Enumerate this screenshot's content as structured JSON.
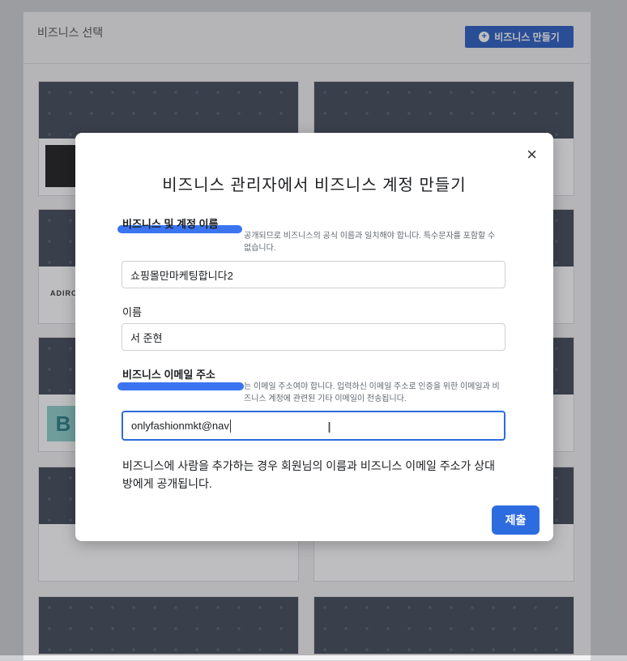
{
  "background": {
    "section_title": "비즈니스 선택",
    "create_button_label": "비즈니스 만들기",
    "cards": [
      {
        "logo_text": ""
      },
      {
        "logo_text": ""
      },
      {
        "logo_text": "ADIRO"
      },
      {
        "logo_text": ""
      },
      {
        "logo_text": "B"
      },
      {
        "logo_text": ""
      }
    ]
  },
  "modal": {
    "title": "비즈니스 관리자에서 비즈니스 계정 만들기",
    "close_symbol": "×",
    "business_name": {
      "label": "비즈니스 및 계정 이름",
      "help": "공개되므로 비즈니스의 공식 이름과 일치해야 합니다. 특수문자를 포함할 수 없습니다.",
      "value": "쇼핑몰만마케팅합니다2"
    },
    "person_name": {
      "label": "이름",
      "value": "서 준현"
    },
    "business_email": {
      "label": "비즈니스 이메일 주소",
      "help": "는 이메일 주소여야 합니다. 입력하신 이메일 주소로 인증을 위한 이메일과 비즈니스 계정에 관련된 기타 이메일이 전송됩니다.",
      "value": "onlyfashionmkt@nav"
    },
    "notice": "비즈니스에 사람을 추가하는 경우 회원님의 이름과 비즈니스 이메일 주소가 상대방에게 공개됩니다.",
    "submit_label": "제출"
  },
  "colors": {
    "primary": "#2d6cdf",
    "marker": "#2f6df0",
    "banner": "#424a5a"
  }
}
